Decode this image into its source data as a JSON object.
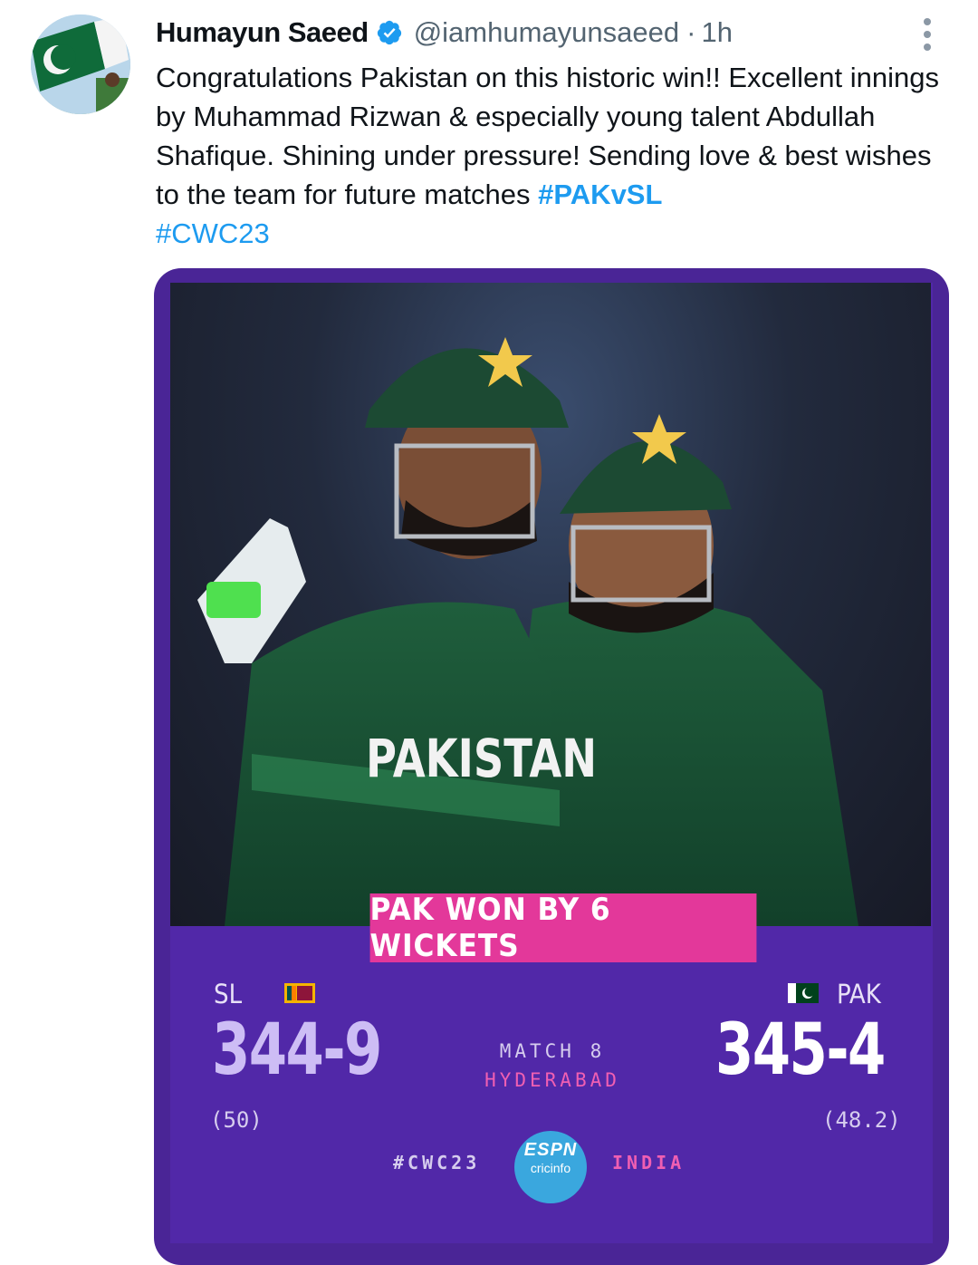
{
  "author": {
    "name": "Humayun Saeed",
    "handle": "@iamhumayunsaeed",
    "separator": "·",
    "time": "1h"
  },
  "tweet": {
    "body": "Congratulations Pakistan on this historic win!! Excellent innings by Muhammad Rizwan & especially young talent Abdullah Shafique. Shining under pressure! Sending love & best wishes to the team for future matches",
    "hashtags": [
      "#PAKvSL",
      "#CWC23"
    ]
  },
  "card": {
    "result": "PAK WON BY 6 WICKETS",
    "jersey_text": "PAKISTAN",
    "team1": {
      "name": "SL",
      "score": "344-9",
      "overs": "(50)"
    },
    "team2": {
      "name": "PAK",
      "score": "345-4",
      "overs": "(48.2)"
    },
    "match_number": "MATCH 8",
    "venue": "HYDERABAD",
    "tournament_tag": "#CWC23",
    "country": "INDIA",
    "logo_top": "ESPN",
    "logo_bottom": "cricinfo"
  },
  "colors": {
    "card_bg": "#5128a8",
    "banner": "#e3389a",
    "venue_text": "#f05fb2",
    "link": "#1d9bf0"
  },
  "icons": [
    "verified-badge-icon",
    "more-options-icon",
    "sri-lanka-flag-icon",
    "pakistan-flag-icon",
    "espncricinfo-logo"
  ]
}
